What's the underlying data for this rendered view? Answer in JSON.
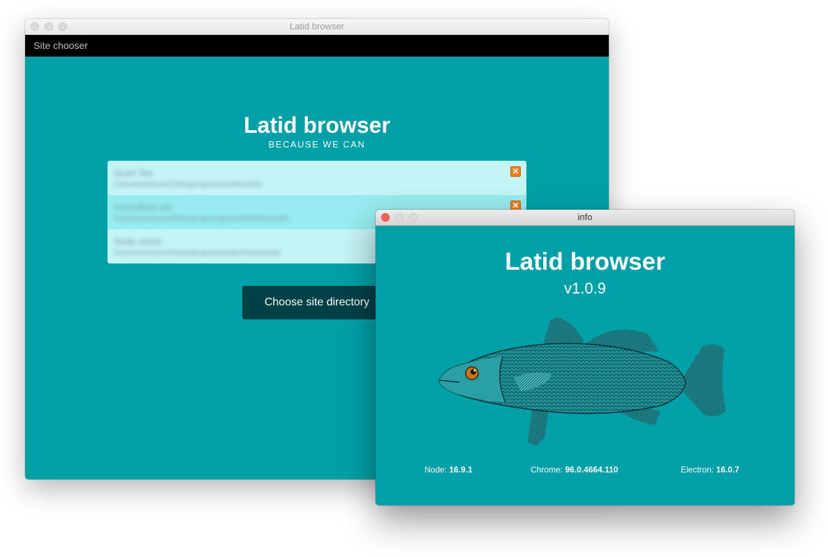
{
  "main_window": {
    "title": "Latid browser",
    "menu": "Site chooser",
    "app_title": "Latid browser",
    "tagline": "BECAUSE WE CAN",
    "sites": [
      {
        "name": "Snart Tea",
        "path": "/Users/someone/Sites/projects/snarttea/site"
      },
      {
        "name": "Greenfield site",
        "path": "/Users/someone/Sites/projects/greenfield/site/public"
      },
      {
        "name": "Static sheet",
        "path": "/Users/someone/Sites/projects/static/sheet/public"
      }
    ],
    "remove_icon": "x-icon",
    "choose_button": "Choose site directory"
  },
  "info_window": {
    "title": "info",
    "app_title": "Latid browser",
    "version": "v1.0.9",
    "node_label": "Node:",
    "node_version": "16.9.1",
    "chrome_label": "Chrome:",
    "chrome_version": "96.0.4664.110",
    "electron_label": "Electron:",
    "electron_version": "16.0.7"
  },
  "colors": {
    "teal": "#00a0a8",
    "dark_button": "#004147",
    "orange": "#ef7d1a"
  }
}
